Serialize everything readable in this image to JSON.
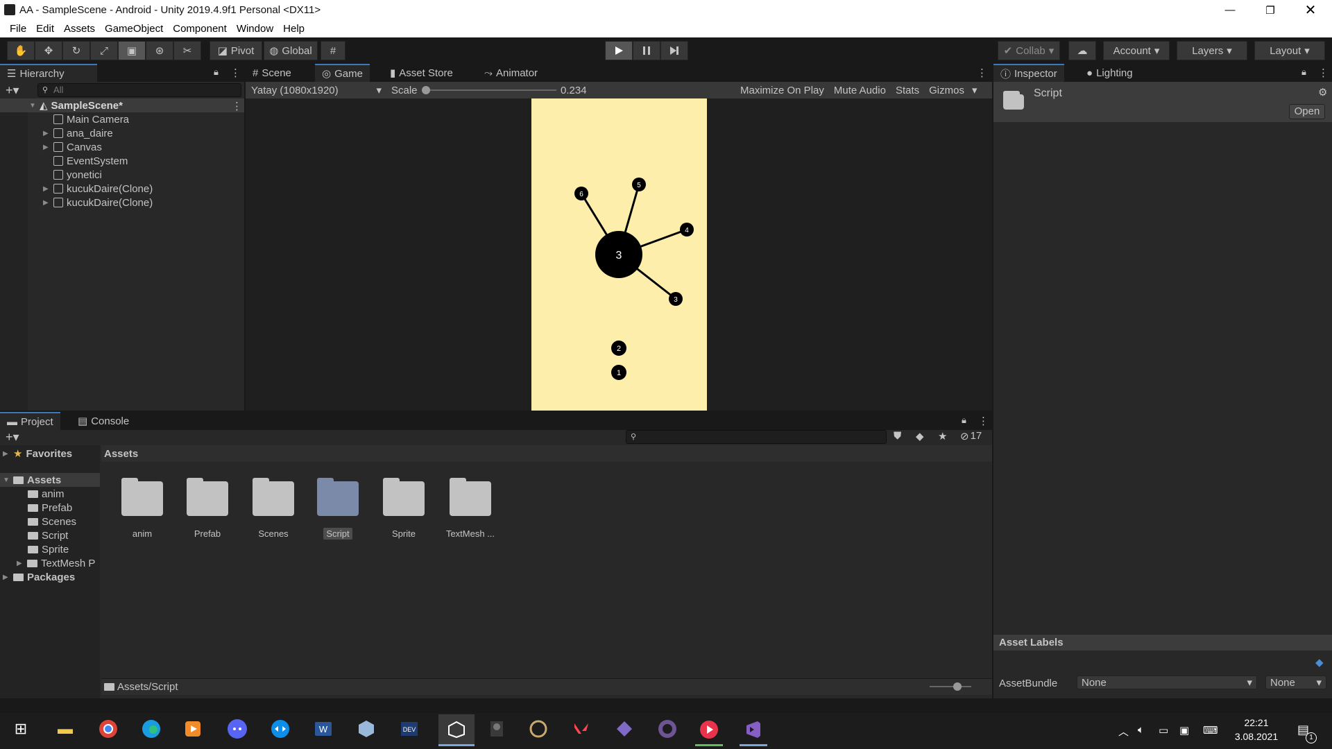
{
  "window": {
    "title": "AA - SampleScene - Android - Unity 2019.4.9f1 Personal <DX11>"
  },
  "menu": [
    "File",
    "Edit",
    "Assets",
    "GameObject",
    "Component",
    "Window",
    "Help"
  ],
  "toolbar": {
    "pivot": "Pivot",
    "global": "Global",
    "collab": "Collab",
    "account": "Account",
    "layers": "Layers",
    "layout": "Layout"
  },
  "hierarchy": {
    "tab": "Hierarchy",
    "search_placeholder": "All",
    "scene": "SampleScene*",
    "items": [
      "Main Camera",
      "ana_daire",
      "Canvas",
      "EventSystem",
      "yonetici",
      "kucukDaire(Clone)",
      "kucukDaire(Clone)"
    ]
  },
  "center_tabs": [
    "Scene",
    "Game",
    "Asset Store",
    "Animator"
  ],
  "game": {
    "resolution": "Yatay (1080x1920)",
    "scale_label": "Scale",
    "scale_value": "0.234",
    "maximize": "Maximize On Play",
    "mute": "Mute Audio",
    "stats": "Stats",
    "gizmos": "Gizmos",
    "big_circle_label": "3",
    "pin_labels": [
      "6",
      "5",
      "4",
      "3"
    ],
    "ball_labels": [
      "2",
      "1"
    ]
  },
  "inspector": {
    "tab": "Inspector",
    "lighting_tab": "Lighting",
    "object_name": "Script",
    "open_btn": "Open",
    "asset_labels": "Asset Labels",
    "assetbundle_label": "AssetBundle",
    "assetbundle_value": "None",
    "variant_value": "None"
  },
  "project": {
    "tab": "Project",
    "console_tab": "Console",
    "favorites": "Favorites",
    "assets": "Assets",
    "packages": "Packages",
    "tree": [
      "anim",
      "Prefab",
      "Scenes",
      "Script",
      "Sprite",
      "TextMesh P"
    ],
    "grid_title": "Assets",
    "folders": [
      "anim",
      "Prefab",
      "Scenes",
      "Script",
      "Sprite",
      "TextMesh ..."
    ],
    "selected_folder": "Script",
    "path": "Assets/Script",
    "hidden_count": "17"
  },
  "taskbar": {
    "time": "22:21",
    "date": "3.08.2021",
    "notif_count": "1"
  },
  "colors": {
    "accent": "#3a79bb",
    "game_bg": "#fdeeab",
    "play": "#4a6ea5"
  }
}
